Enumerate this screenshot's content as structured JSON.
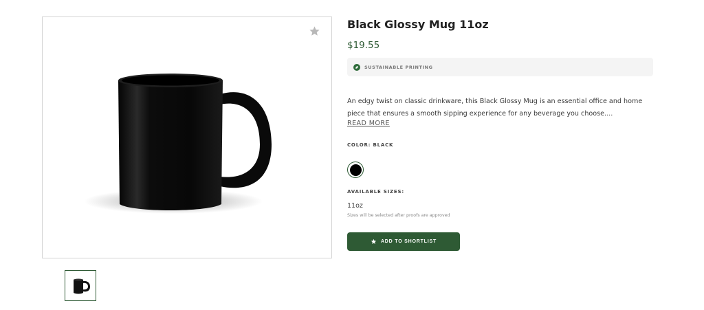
{
  "product": {
    "title": "Black Glossy Mug 11oz",
    "price": "$19.55",
    "badge_label": "SUSTAINABLE PRINTING",
    "description": "An edgy twist on classic drinkware, this Black Glossy Mug is an essential office and home piece that ensures a smooth sipping experience for any beverage you choose....",
    "read_more_label": "READ MORE",
    "color_label": "COLOR: BLACK",
    "selected_color": "#000000",
    "sizes_label": "AVAILABLE SIZES:",
    "size_value": "11oz",
    "size_note": "Sizes will be selected after proofs are approved",
    "cta_label": "ADD TO SHORTLIST"
  },
  "icons": {
    "favorite": "star-icon",
    "badge": "leaf-icon",
    "cta": "star-icon"
  },
  "colors": {
    "brand_green": "#2e5a34",
    "price_green": "#2e5a34",
    "badge_bg": "#f4f4f4"
  }
}
